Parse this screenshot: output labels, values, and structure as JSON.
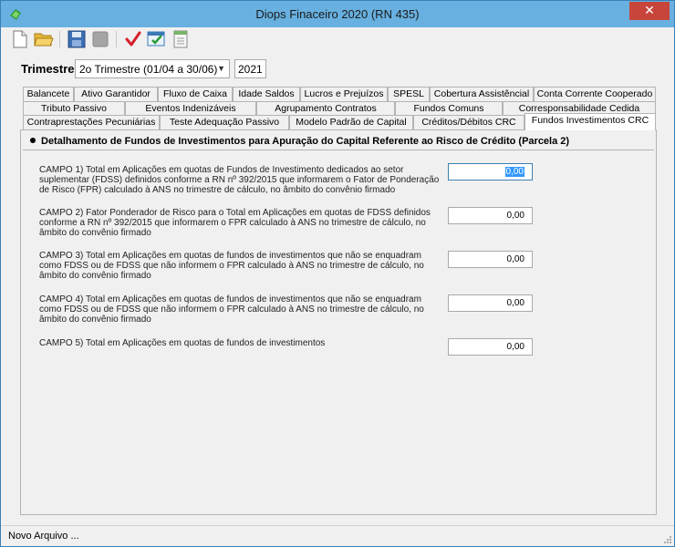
{
  "window": {
    "title": "Diops Finaceiro 2020 (RN 435)",
    "close_glyph": "✕"
  },
  "toolbar": {
    "buttons": [
      {
        "name": "new-file-icon"
      },
      {
        "name": "open-folder-icon"
      },
      {
        "name": "save-disk-icon"
      },
      {
        "name": "disabled-icon"
      },
      {
        "name": "checkmark-icon"
      },
      {
        "name": "validate-window-icon"
      },
      {
        "name": "report-icon"
      }
    ]
  },
  "period": {
    "label": "Trimestre",
    "selected": "2o Trimestre (01/04 a 30/06)",
    "year": "2021"
  },
  "tabs": {
    "row1": [
      "Balancete",
      "Ativo Garantidor",
      "Fluxo de Caixa",
      "Idade Saldos",
      "Lucros e Prejuízos",
      "SPESL",
      "Cobertura Assistêncial",
      "Conta Corrente Cooperado"
    ],
    "row2": [
      "Tributo Passivo",
      "Eventos Indenizáveis",
      "Agrupamento Contratos",
      "Fundos Comuns",
      "Corresponsabilidade Cedida"
    ],
    "row3": [
      "Contraprestações Pecuniárias",
      "Teste Adequação Passivo",
      "Modelo Padrão de Capital",
      "Créditos/Débitos CRC",
      "Fundos Investimentos CRC"
    ]
  },
  "panel": {
    "heading": "Detalhamento de Fundos de Investimentos para Apuração do Capital Referente ao Risco de Crédito (Parcela 2)",
    "campos": [
      {
        "label": "CAMPO 1) Total em Aplicações em quotas de Fundos de Investimento dedicados ao setor suplementar (FDSS) definidos conforme a RN nº 392/2015 que informarem o Fator de Ponderação de Risco (FPR) calculado à ANS no trimestre de cálculo, no âmbito do convênio firmado",
        "value": "0,00"
      },
      {
        "label": "CAMPO 2) Fator Ponderador de Risco para o Total em Aplicações em quotas de FDSS definidos conforme a RN nº 392/2015 que informarem o FPR calculado à ANS no trimestre de cálculo, no âmbito do convênio firmado",
        "value": "0,00"
      },
      {
        "label": "CAMPO 3) Total em Aplicações em quotas de fundos de investimentos que não se enquadram como FDSS ou de FDSS que não informem o FPR calculado à ANS no trimestre de cálculo, no âmbito do convênio firmado",
        "value": "0,00"
      },
      {
        "label": "CAMPO 4) Total em Aplicações em quotas de fundos de investimentos que não se enquadram como FDSS ou de FDSS que não informem o FPR calculado à ANS no trimestre de cálculo, no âmbito do convênio firmado",
        "value": "0,00"
      },
      {
        "label": "CAMPO 5) Total em Aplicações em quotas de fundos de investimentos",
        "value": "0,00"
      }
    ]
  },
  "status": {
    "text": "Novo Arquivo ..."
  }
}
